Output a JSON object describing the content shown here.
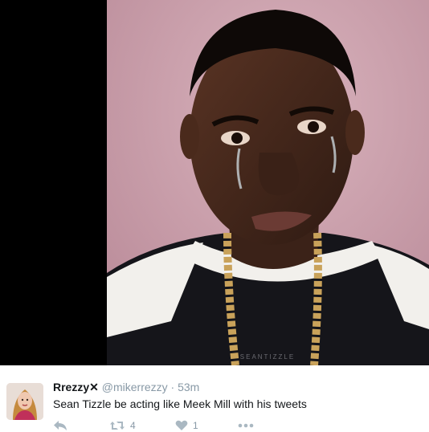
{
  "colors": {
    "media_left_bg": "#000000",
    "photo_bg": "#c99ca8",
    "text": "#14171a",
    "muted": "#8899a6",
    "icon": "#aab8c2"
  },
  "media": {
    "left_panel": "black-panel",
    "photo": "crying-man-photo",
    "photo_watermark": "SEANTIZZLE"
  },
  "tweet": {
    "display_name": "Rrezzy",
    "badge": "✕",
    "handle": "@mikerrezzy",
    "separator": "·",
    "time": "53m",
    "text": "Sean Tizzle be acting like Meek Mill with his tweets",
    "actions": {
      "reply_icon": "reply-icon",
      "retweet_icon": "retweet-icon",
      "retweet_count": "4",
      "like_icon": "heart-icon",
      "like_count": "1",
      "more_icon": "more-icon"
    }
  }
}
